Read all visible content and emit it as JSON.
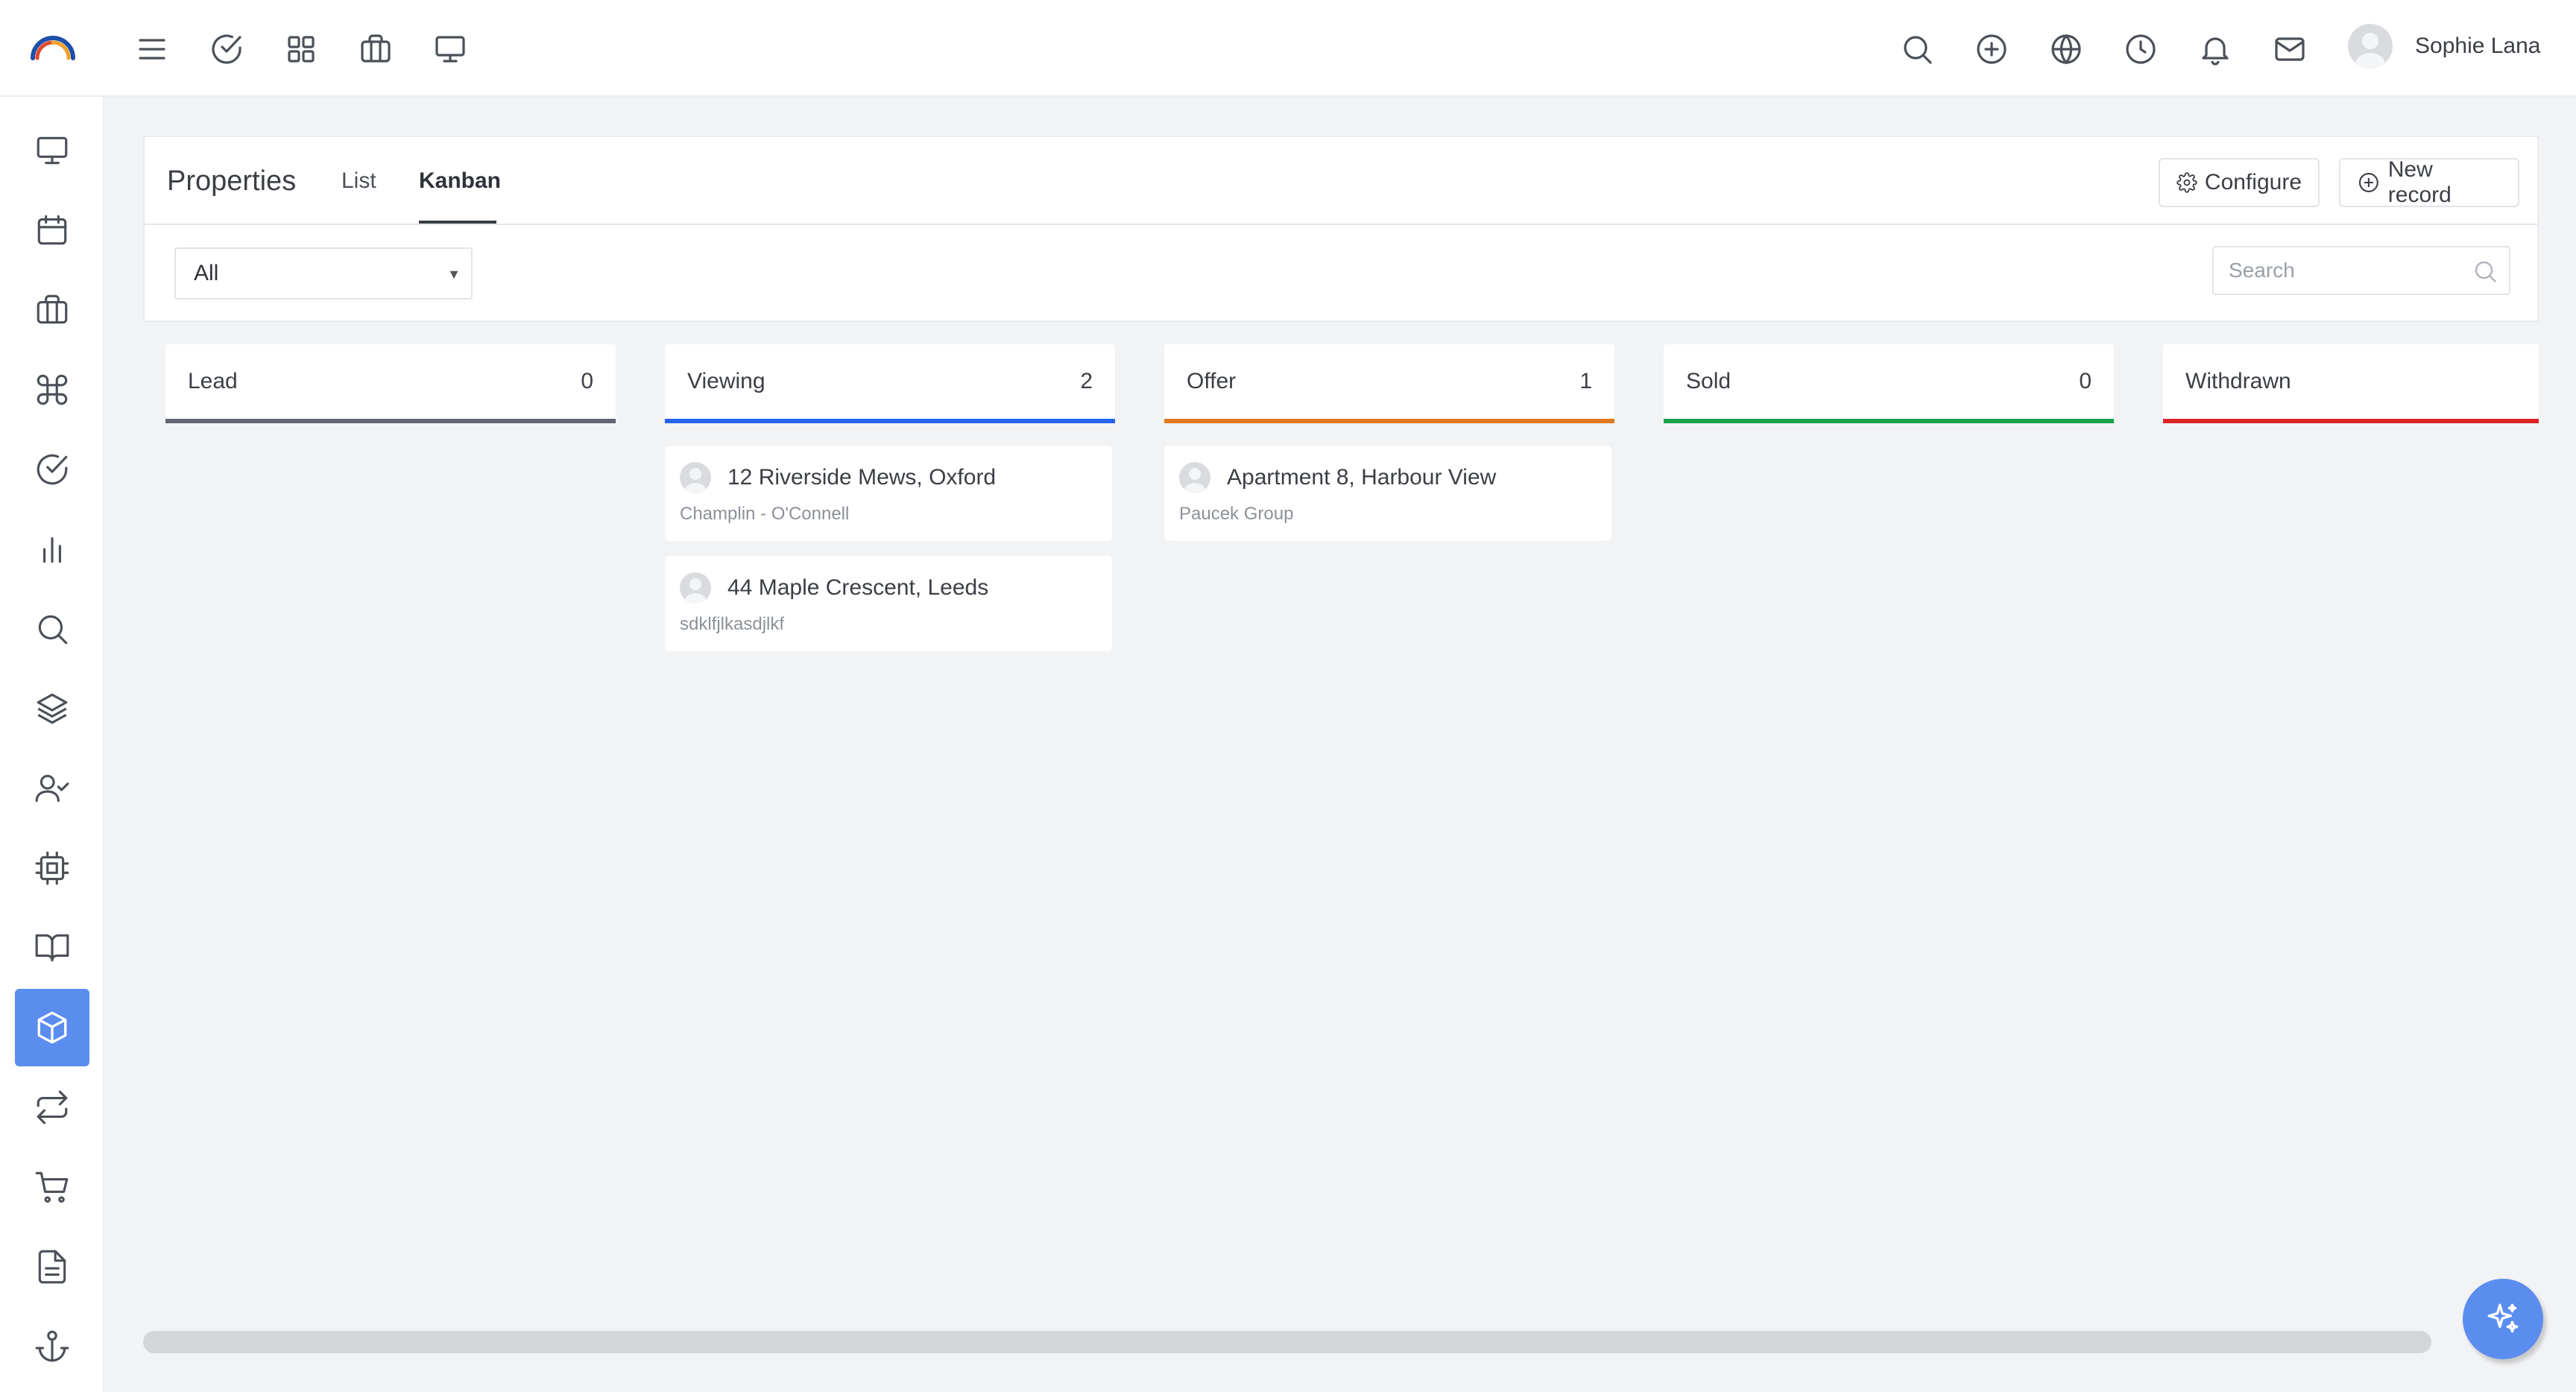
{
  "topbar": {
    "left_icons": [
      "menu-icon",
      "check-circle-icon",
      "grid-icon",
      "briefcase-icon",
      "monitor-icon"
    ],
    "right_icons": [
      "search-icon",
      "plus-circle-icon",
      "globe-icon",
      "clock-icon",
      "bell-icon",
      "mail-icon"
    ],
    "user_name": "Sophie Lana"
  },
  "sidebar": {
    "items": [
      "monitor-icon",
      "calendar-icon",
      "briefcase-icon",
      "command-icon",
      "check-circle-icon",
      "bar-chart-icon",
      "search-icon",
      "layers-icon",
      "user-check-icon",
      "cpu-icon",
      "book-icon",
      "box-icon",
      "repeat-icon",
      "cart-icon",
      "file-text-icon",
      "anchor-icon"
    ],
    "active": "box-icon"
  },
  "header": {
    "title": "Properties",
    "tabs": [
      {
        "label": "List"
      },
      {
        "label": "Kanban",
        "active": true
      }
    ],
    "configure_label": "Configure",
    "new_record_label": "New record"
  },
  "filter": {
    "selected": "All",
    "search_placeholder": "Search"
  },
  "kanban": {
    "columns": [
      {
        "name": "Lead",
        "count": "0",
        "color": "#616670",
        "cards": []
      },
      {
        "name": "Viewing",
        "count": "2",
        "color": "#2563eb",
        "cards": [
          {
            "title": "12 Riverside Mews, Oxford",
            "subtitle": "Champlin - O'Connell"
          },
          {
            "title": "44 Maple Crescent, Leeds",
            "subtitle": "sdklfjlkasdjlkf"
          }
        ]
      },
      {
        "name": "Offer",
        "count": "1",
        "color": "#e07a1f",
        "cards": [
          {
            "title": "Apartment 8, Harbour View",
            "subtitle": "Paucek Group"
          }
        ]
      },
      {
        "name": "Sold",
        "count": "0",
        "color": "#16a34a",
        "cards": []
      },
      {
        "name": "Withdrawn",
        "count": "",
        "color": "#dc2626",
        "cards": []
      }
    ]
  },
  "colors": {
    "accent": "#5b8def"
  }
}
